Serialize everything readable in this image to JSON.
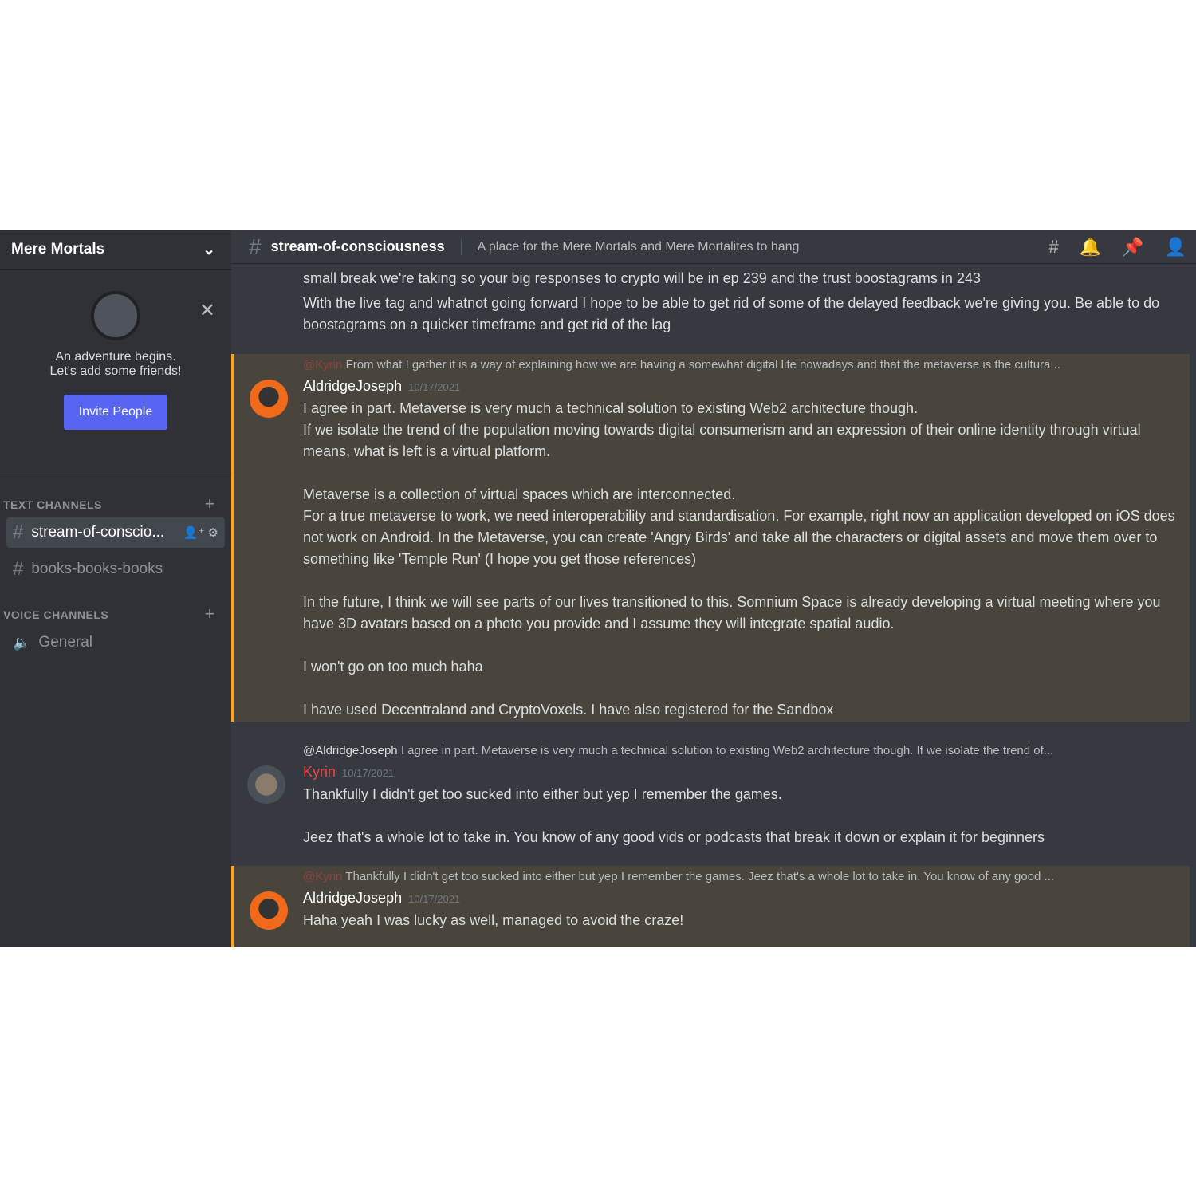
{
  "server": {
    "name": "Mere Mortals"
  },
  "welcome": {
    "line1": "An adventure begins.",
    "line2": "Let's add some friends!",
    "invite": "Invite People"
  },
  "sidebar": {
    "text_header": "TEXT CHANNELS",
    "voice_header": "VOICE CHANNELS",
    "text_channels": [
      {
        "name": "stream-of-conscio..."
      },
      {
        "name": "books-books-books"
      }
    ],
    "voice_channels": [
      {
        "name": "General"
      }
    ]
  },
  "channel": {
    "name": "stream-of-consciousness",
    "topic": "A place for the Mere Mortals and Mere Mortalites to hang"
  },
  "messages": {
    "m0": {
      "lines": [
        "small break we're taking so your big responses to crypto will be in ep 239 and the trust boostagrams in 243",
        "With the live tag and whatnot going forward I hope to be able to get rid of some of the delayed feedback we're giving you. Be able to do boostagrams on a quicker timeframe and get rid of the lag"
      ]
    },
    "m1": {
      "reply_user": "@Kyrin",
      "reply_text": "From what I gather it is a way of explaining how we are having a somewhat digital life nowadays and that the metaverse is the cultura...",
      "author": "AldridgeJoseph",
      "time": "10/17/2021",
      "lines": [
        "I agree in part. Metaverse is very much a technical solution to existing Web2 architecture though.",
        "If we isolate the trend of the population moving towards digital consumerism and an expression of their online identity through virtual means, what is left is a virtual platform.",
        "",
        "Metaverse is a collection of virtual spaces which are interconnected.",
        "For a true metaverse to work, we need interoperability and standardisation. For example, right now an application developed on iOS does not work on Android. In the Metaverse, you can create 'Angry Birds' and take all the characters or digital assets and move them over to something like 'Temple Run' (I hope you get those references)",
        "",
        "In the future, I think we will see parts of our lives transitioned to this. Somnium Space is already developing a virtual meeting where you have 3D avatars based on a photo you provide and I assume they will integrate spatial audio.",
        "",
        "I won't go on too much haha",
        "",
        "I have used Decentraland and CryptoVoxels. I have also registered for the Sandbox"
      ]
    },
    "m2": {
      "reply_user": "@AldridgeJoseph",
      "reply_text": "I agree in part. Metaverse is very much a technical solution to existing Web2 architecture though.  If we isolate the trend of...",
      "author": "Kyrin",
      "time": "10/17/2021",
      "lines": [
        "Thankfully I didn't get too sucked into either but yep I remember the games.",
        "",
        "Jeez that's a whole lot to take in. You know of any good vids or podcasts that break it down or explain it for beginners"
      ]
    },
    "m3": {
      "reply_user": "@Kyrin",
      "reply_text": "Thankfully I didn't get too sucked into either but yep I remember the games.  Jeez that's a whole lot to take in. You know of any good ...",
      "author": "AldridgeJoseph",
      "time": "10/17/2021",
      "lines": [
        "Haha yeah I was lucky as well, managed to avoid the craze!"
      ]
    }
  },
  "colors": {
    "accent": "#5865f2",
    "mention_bar": "#faa61a",
    "kyrin": "#ed4245"
  }
}
